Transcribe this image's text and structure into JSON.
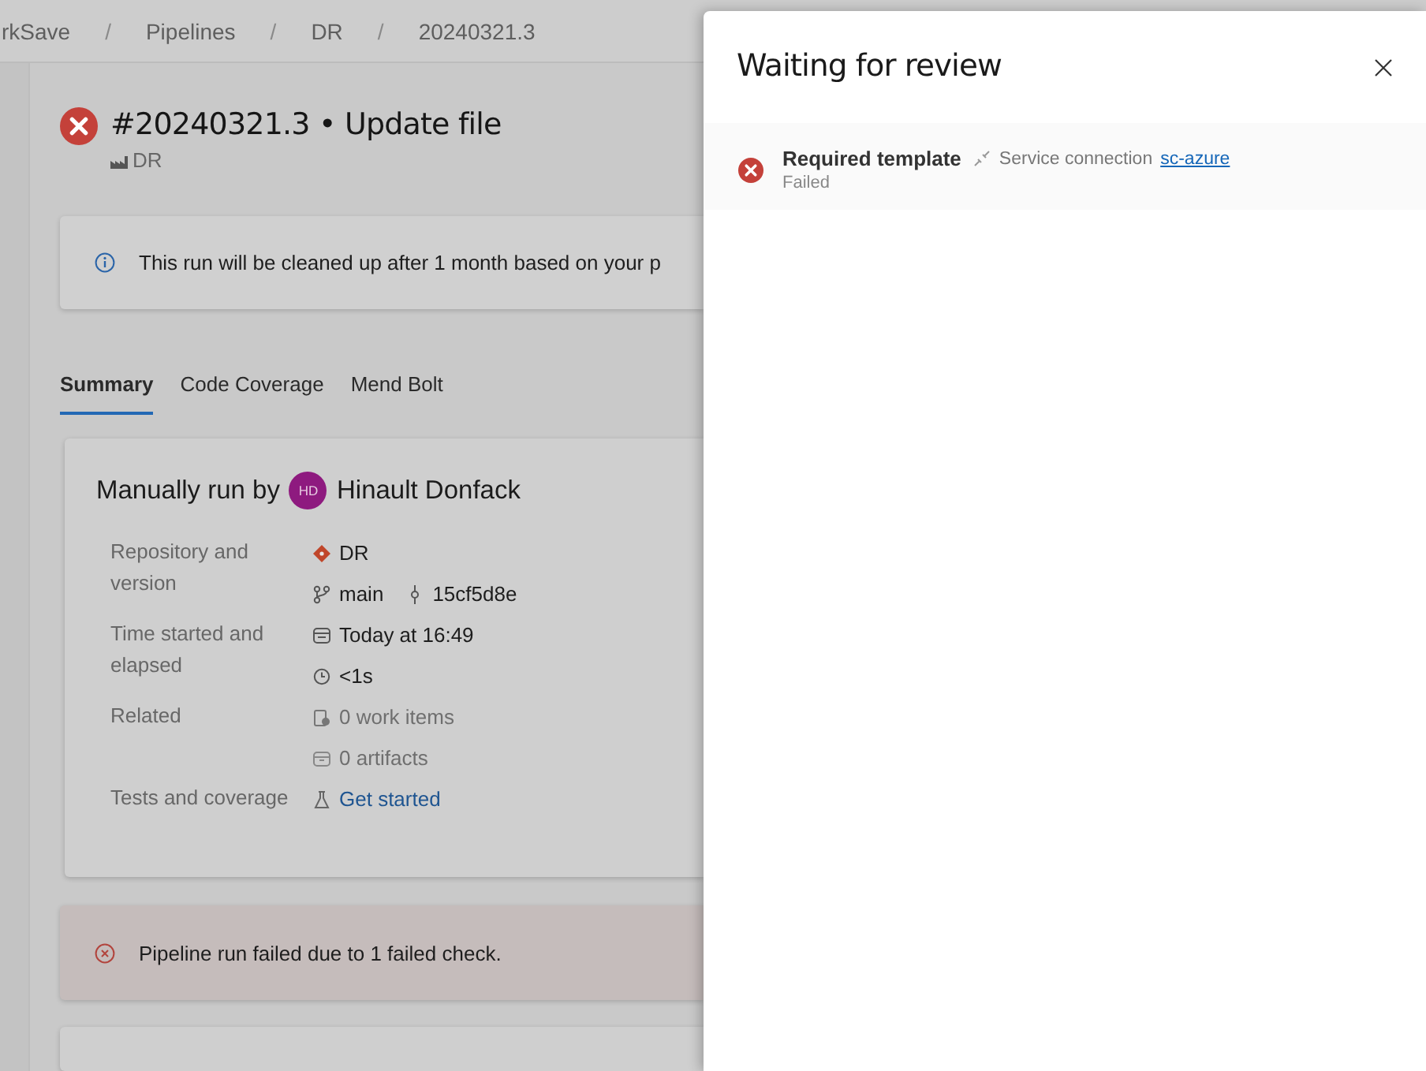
{
  "breadcrumb": [
    {
      "kind": "link",
      "text": "rkSave"
    },
    {
      "kind": "separator",
      "text": "/"
    },
    {
      "kind": "link",
      "text": "Pipelines"
    },
    {
      "kind": "separator",
      "text": "/"
    },
    {
      "kind": "link",
      "text": "DR"
    },
    {
      "kind": "separator",
      "text": "/"
    },
    {
      "kind": "link",
      "text": "20240321.3"
    }
  ],
  "run": {
    "failed": true,
    "title": "#20240321.3 • Update file",
    "pipeline": "DR"
  },
  "info_banner": {
    "text": "This run will be cleaned up after 1 month based on your p"
  },
  "tabs": [
    {
      "label": "Summary",
      "selected": true
    },
    {
      "label": "Code Coverage",
      "selected": false
    },
    {
      "label": "Mend Bolt",
      "selected": false
    }
  ],
  "summary": {
    "heading": "Manually run by",
    "user": {
      "initials": "HD",
      "name": "Hinault Donfack"
    },
    "details": [
      {
        "label": "Repository and version",
        "lines": [
          [
            {
              "kind": "repo",
              "text": "DR"
            }
          ],
          [
            {
              "kind": "branch",
              "text": "main"
            },
            {
              "kind": "commit",
              "text": "15cf5d8e"
            }
          ]
        ]
      },
      {
        "label": "Time started and elapsed",
        "lines": [
          [
            {
              "kind": "calendar",
              "text": "Today at 16:49"
            }
          ],
          [
            {
              "kind": "clock",
              "text": "<1s"
            }
          ]
        ]
      },
      {
        "label": "Related",
        "lines": [
          [
            {
              "kind": "workitem",
              "text": "0 work items"
            }
          ],
          [
            {
              "kind": "artifact",
              "text": "0 artifacts"
            }
          ]
        ]
      },
      {
        "label": "Tests and coverage",
        "lines": [
          [
            {
              "kind": "test",
              "text": "Get started"
            }
          ]
        ]
      }
    ]
  },
  "error_banner": {
    "text": "Pipeline run failed due to 1 failed check."
  },
  "panel": {
    "title": "Waiting for review",
    "checks": [
      {
        "failed": true,
        "name": "Required template",
        "resource_type": "Service connection",
        "resource": "sc-azure",
        "state": "Failed"
      }
    ]
  }
}
